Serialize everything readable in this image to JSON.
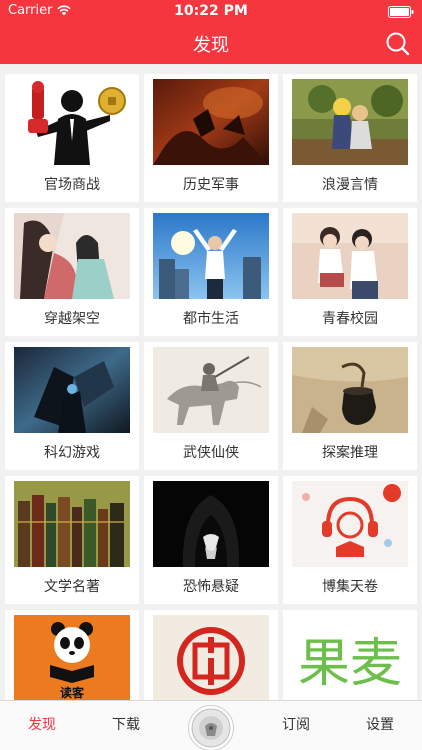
{
  "status_bar": {
    "carrier": "Carrier",
    "time": "10:22 PM"
  },
  "nav": {
    "title": "发现"
  },
  "categories": [
    {
      "label": "官场商战",
      "icon": "businessman-coins-image"
    },
    {
      "label": "历史军事",
      "icon": "battle-painting-image"
    },
    {
      "label": "浪漫言情",
      "icon": "anime-couple-image"
    },
    {
      "label": "穿越架空",
      "icon": "ancient-couple-image"
    },
    {
      "label": "都市生活",
      "icon": "city-man-image"
    },
    {
      "label": "青春校园",
      "icon": "school-couple-image"
    },
    {
      "label": "科幻游戏",
      "icon": "scifi-game-image"
    },
    {
      "label": "武侠仙侠",
      "icon": "wuxia-horse-image"
    },
    {
      "label": "探案推理",
      "icon": "detective-pipe-image"
    },
    {
      "label": "文学名著",
      "icon": "books-image"
    },
    {
      "label": "恐怖悬疑",
      "icon": "hooded-figure-image"
    },
    {
      "label": "博集天卷",
      "icon": "headphone-logo-image"
    },
    {
      "label": "",
      "icon": "panda-reader-logo-image"
    },
    {
      "label": "",
      "icon": "red-seal-logo-image"
    },
    {
      "label": "",
      "icon": "green-brand-logo-image"
    }
  ],
  "cover_text": {
    "panda_logo": "读客",
    "green_logo": "果麦"
  },
  "tabbar": {
    "discover": "发现",
    "download": "下载",
    "subscribe": "订阅",
    "settings": "设置"
  },
  "colors": {
    "brand_red": "#f6363f",
    "text": "#333333"
  }
}
